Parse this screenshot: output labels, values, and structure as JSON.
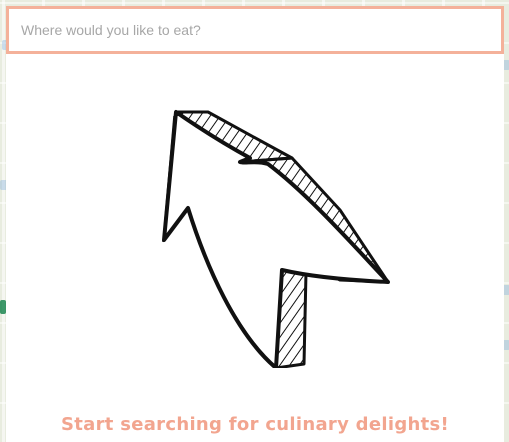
{
  "search": {
    "placeholder": "Where would you like to eat?",
    "value": ""
  },
  "illustration": {
    "icon": "hand-drawn-arrow-icon"
  },
  "cta": {
    "text": "Start searching for culinary delights!"
  },
  "colors": {
    "accent": "#f4b19a",
    "cta_text": "#f2a58f",
    "panel_bg": "#ffffff",
    "map_bg": "#e8ecdf"
  }
}
